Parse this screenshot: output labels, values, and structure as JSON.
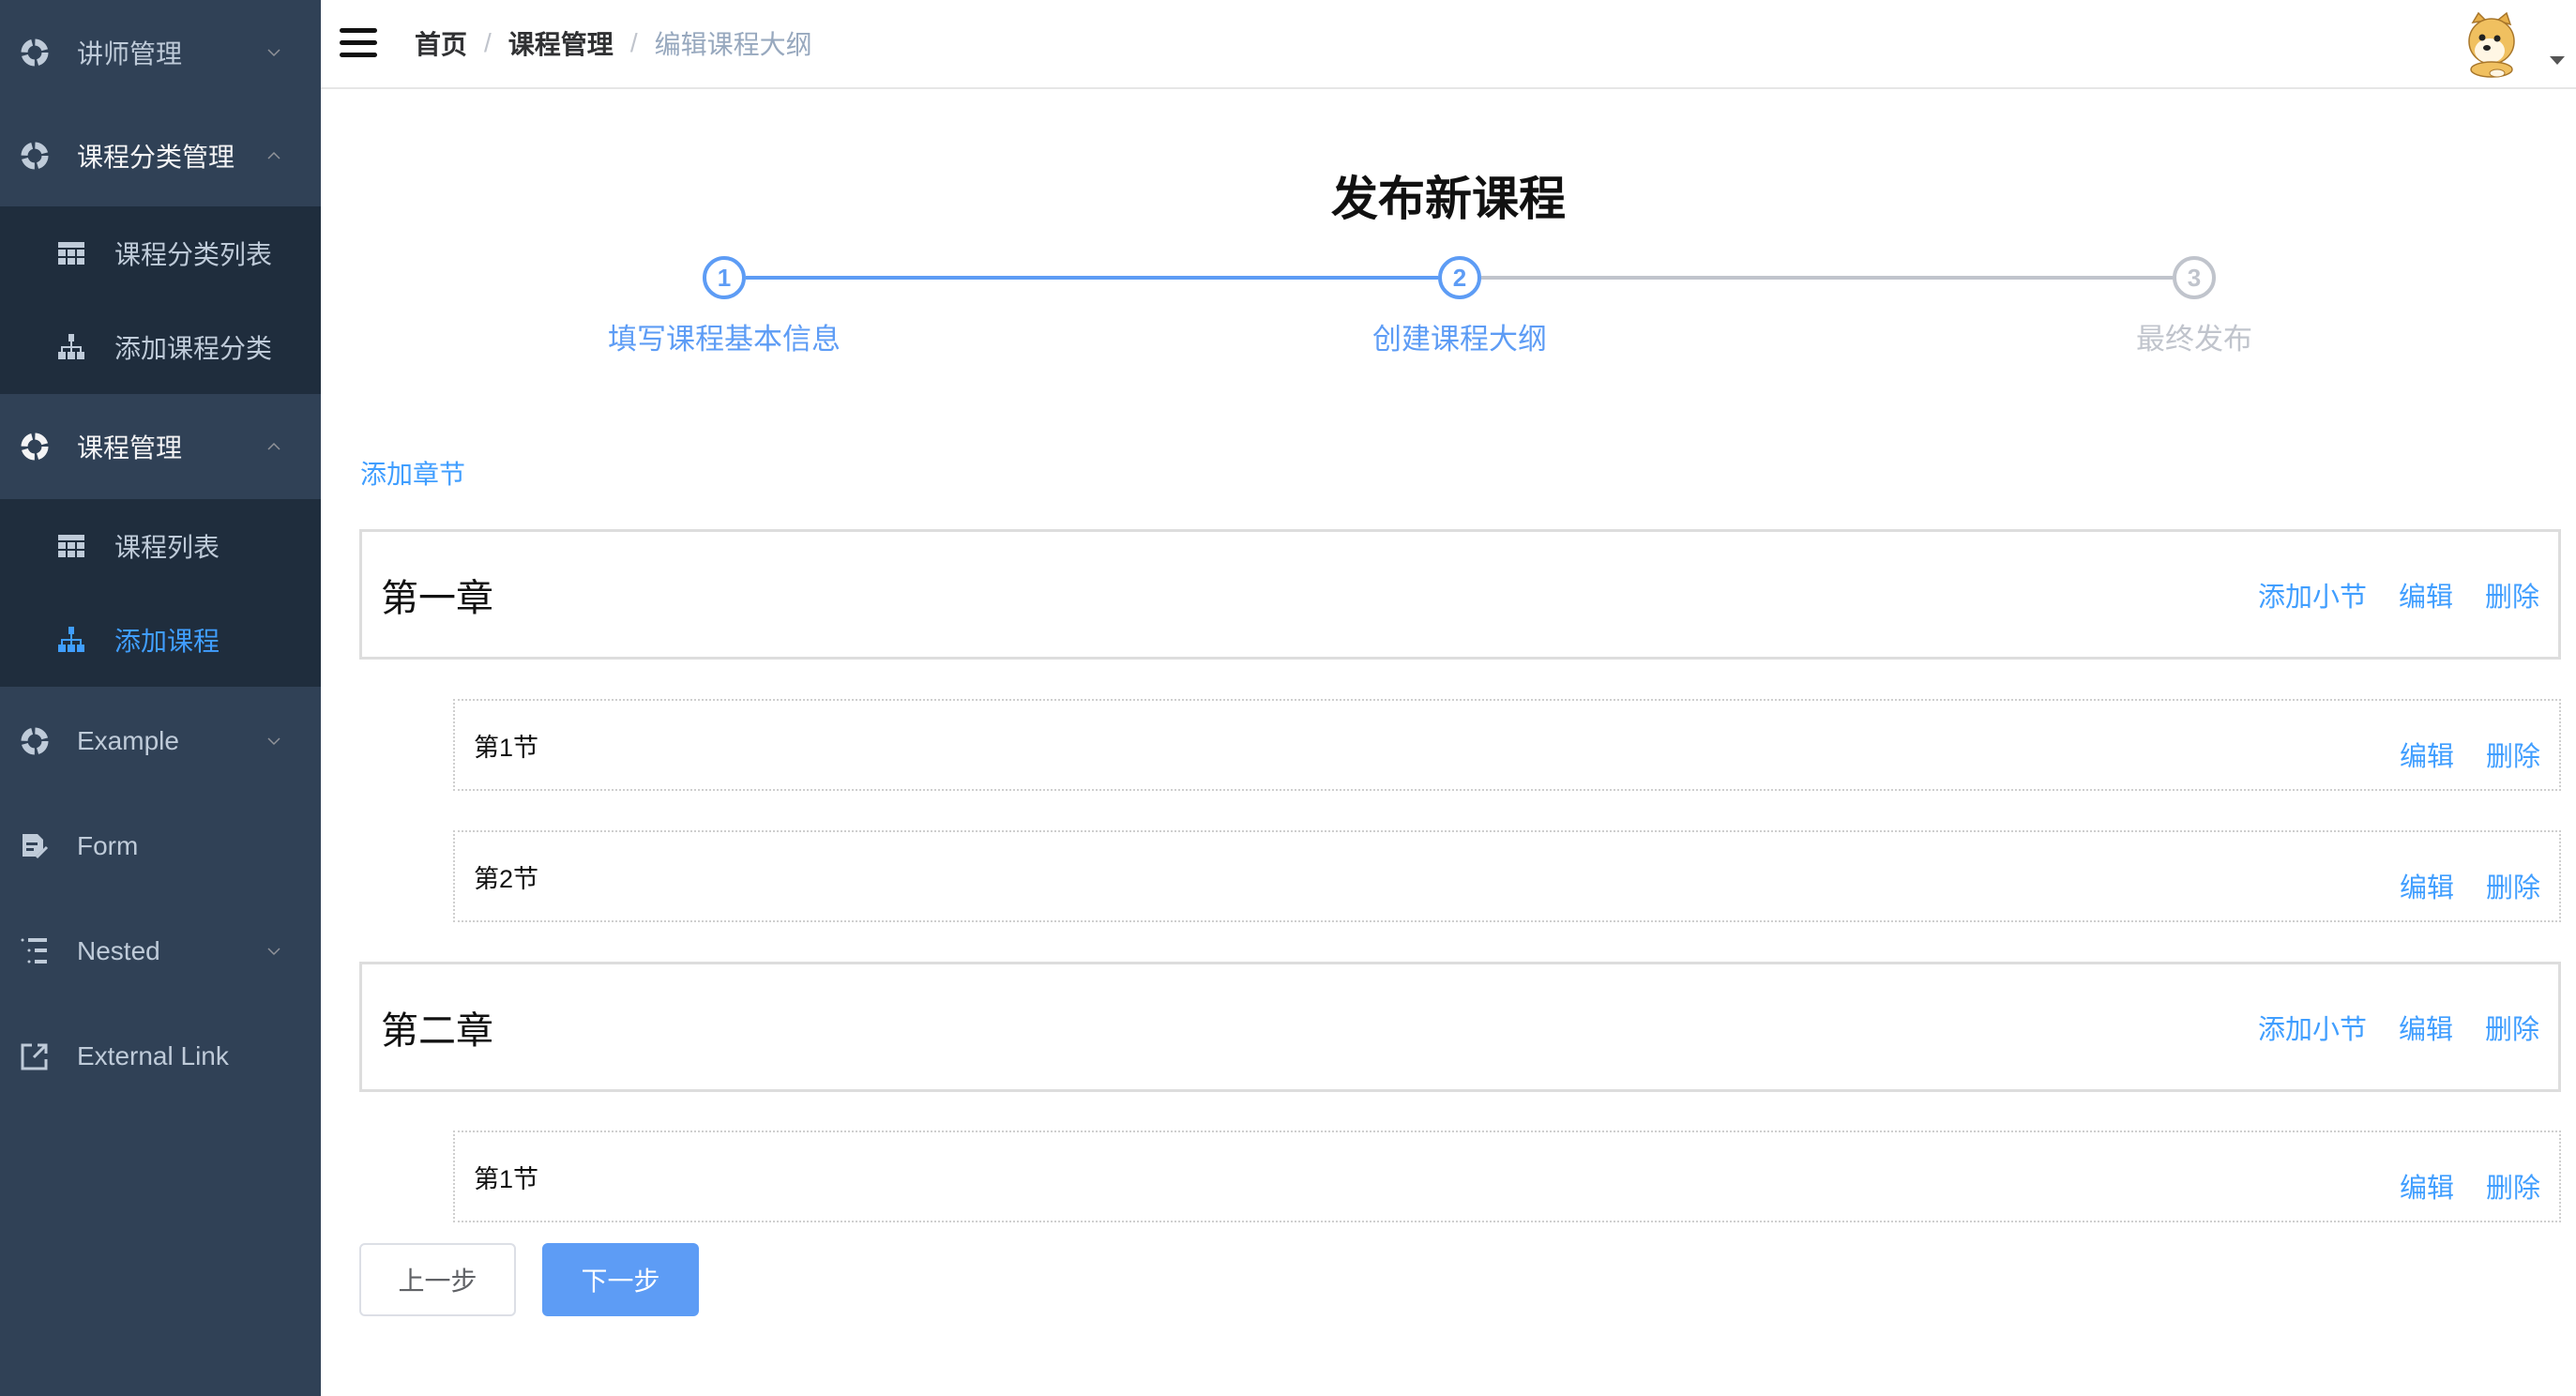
{
  "colors": {
    "sidebar_bg": "#304156",
    "submenu_bg": "#1f2d3d",
    "accent": "#409eff",
    "inactive_step": "#c0c4cc",
    "primary_button": "#5d9cf5"
  },
  "sidebar": {
    "items": [
      {
        "label": "讲师管理",
        "icon": "component-icon",
        "arrow": "chevron-down-icon"
      },
      {
        "label": "课程分类管理",
        "icon": "component-icon",
        "arrow": "chevron-up-icon",
        "children": [
          {
            "label": "课程分类列表",
            "icon": "table-icon"
          },
          {
            "label": "添加课程分类",
            "icon": "tree-icon"
          }
        ]
      },
      {
        "label": "课程管理",
        "icon": "component-icon",
        "arrow": "chevron-up-icon",
        "children": [
          {
            "label": "课程列表",
            "icon": "table-icon"
          },
          {
            "label": "添加课程",
            "icon": "tree-icon",
            "active": true
          }
        ]
      },
      {
        "label": "Example",
        "icon": "component-icon",
        "arrow": "chevron-down-icon"
      },
      {
        "label": "Form",
        "icon": "form-icon"
      },
      {
        "label": "Nested",
        "icon": "nested-icon",
        "arrow": "chevron-down-icon"
      },
      {
        "label": "External Link",
        "icon": "link-icon"
      }
    ]
  },
  "header": {
    "breadcrumb": [
      "首页",
      "课程管理",
      "编辑课程大纲"
    ],
    "separator": "/"
  },
  "main": {
    "title": "发布新课程",
    "steps": [
      {
        "number": "1",
        "label": "填写课程基本信息",
        "status": "finished"
      },
      {
        "number": "2",
        "label": "创建课程大纲",
        "status": "active"
      },
      {
        "number": "3",
        "label": "最终发布",
        "status": "pending"
      }
    ],
    "current_step": 2,
    "add_chapter_label": "添加章节",
    "chapters": [
      {
        "title": "第一章",
        "actions": [
          "添加小节",
          "编辑",
          "删除"
        ],
        "sections": [
          {
            "title": "第1节",
            "actions": [
              "编辑",
              "删除"
            ]
          },
          {
            "title": "第2节",
            "actions": [
              "编辑",
              "删除"
            ]
          }
        ]
      },
      {
        "title": "第二章",
        "actions": [
          "添加小节",
          "编辑",
          "删除"
        ],
        "sections": [
          {
            "title": "第1节",
            "actions": [
              "编辑",
              "删除"
            ]
          }
        ]
      }
    ],
    "prev_button": "上一步",
    "next_button": "下一步"
  }
}
